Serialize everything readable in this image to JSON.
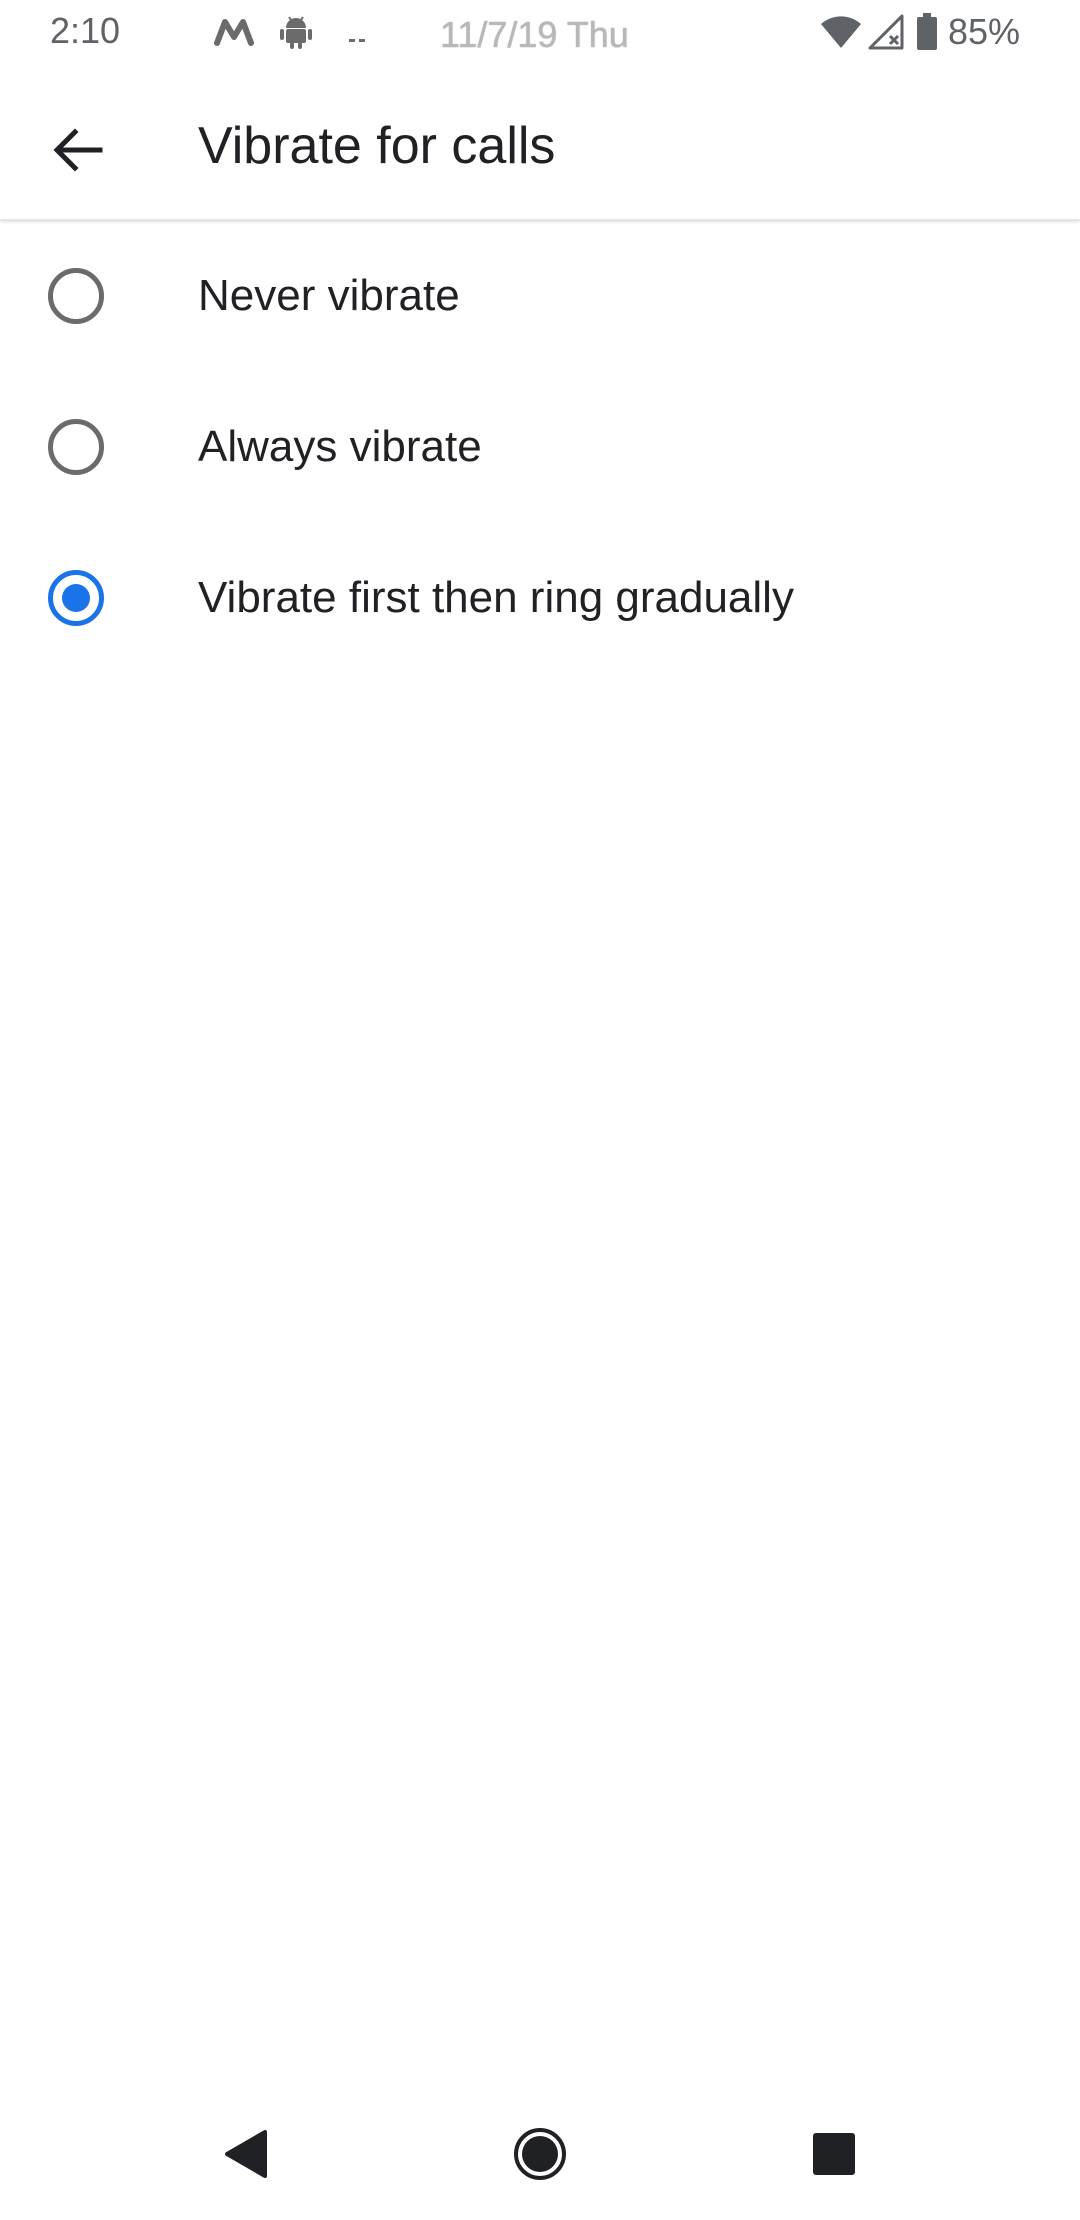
{
  "status_bar": {
    "time": "2:10",
    "notification_icons": [
      "m-logo-icon",
      "android-icon",
      "dots-icon"
    ],
    "date": "11/7/19 Thu",
    "wifi_icon": "wifi-icon",
    "signal_icon": "no-signal-icon",
    "battery_icon": "battery-icon",
    "battery_percent": "85%"
  },
  "app_bar": {
    "back_icon": "arrow-back-icon",
    "title": "Vibrate for calls"
  },
  "options": [
    {
      "label": "Never vibrate",
      "selected": false
    },
    {
      "label": "Always vibrate",
      "selected": false
    },
    {
      "label": "Vibrate first then ring gradually",
      "selected": true
    }
  ],
  "nav_bar": {
    "back": "nav-back-icon",
    "home": "nav-home-icon",
    "recents": "nav-recents-icon"
  },
  "colors": {
    "accent": "#1a73e8",
    "text_primary": "#202124",
    "radio_unchecked": "#6b6b6b",
    "status_text": "#5f6368"
  }
}
